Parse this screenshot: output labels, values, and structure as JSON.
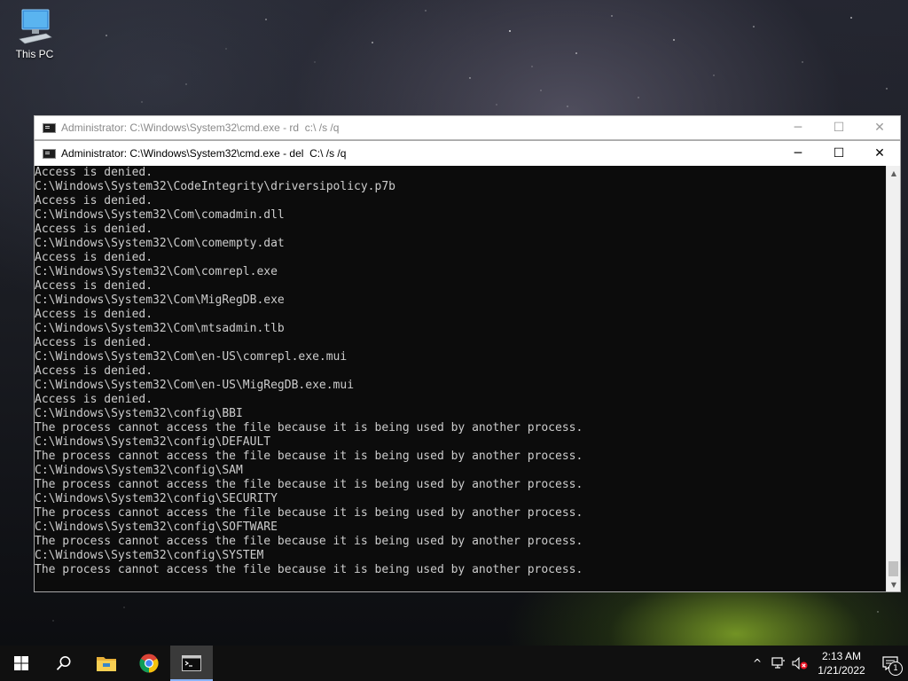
{
  "desktop": {
    "icons": [
      {
        "label": "This PC",
        "icon": "computer-icon"
      }
    ]
  },
  "windows": {
    "back": {
      "title": "Administrator: C:\\Windows\\System32\\cmd.exe - rd  c:\\ /s /q",
      "controls": {
        "minimize": "─",
        "maximize": "☐",
        "close": "✕"
      }
    },
    "front": {
      "title": "Administrator: C:\\Windows\\System32\\cmd.exe - del  C:\\ /s /q",
      "controls": {
        "minimize": "─",
        "maximize": "☐",
        "close": "✕"
      },
      "console_lines": [
        "Access is denied.",
        "C:\\Windows\\System32\\CodeIntegrity\\driversipolicy.p7b",
        "Access is denied.",
        "C:\\Windows\\System32\\Com\\comadmin.dll",
        "Access is denied.",
        "C:\\Windows\\System32\\Com\\comempty.dat",
        "Access is denied.",
        "C:\\Windows\\System32\\Com\\comrepl.exe",
        "Access is denied.",
        "C:\\Windows\\System32\\Com\\MigRegDB.exe",
        "Access is denied.",
        "C:\\Windows\\System32\\Com\\mtsadmin.tlb",
        "Access is denied.",
        "C:\\Windows\\System32\\Com\\en-US\\comrepl.exe.mui",
        "Access is denied.",
        "C:\\Windows\\System32\\Com\\en-US\\MigRegDB.exe.mui",
        "Access is denied.",
        "C:\\Windows\\System32\\config\\BBI",
        "The process cannot access the file because it is being used by another process.",
        "C:\\Windows\\System32\\config\\DEFAULT",
        "The process cannot access the file because it is being used by another process.",
        "C:\\Windows\\System32\\config\\SAM",
        "The process cannot access the file because it is being used by another process.",
        "C:\\Windows\\System32\\config\\SECURITY",
        "The process cannot access the file because it is being used by another process.",
        "C:\\Windows\\System32\\config\\SOFTWARE",
        "The process cannot access the file because it is being used by another process.",
        "C:\\Windows\\System32\\config\\SYSTEM",
        "The process cannot access the file because it is being used by another process."
      ]
    }
  },
  "taskbar": {
    "buttons": [
      "start-icon",
      "search-icon",
      "file-explorer-icon",
      "chrome-icon",
      "cmd-icon"
    ],
    "active_button": "cmd-icon",
    "tray": {
      "chevron": "^",
      "time": "2:13 AM",
      "date": "1/21/2022",
      "notification_count": "1"
    }
  },
  "colors": {
    "console_bg": "#0c0c0c",
    "console_fg": "#cccccc",
    "taskbar_bg": "#101010"
  }
}
